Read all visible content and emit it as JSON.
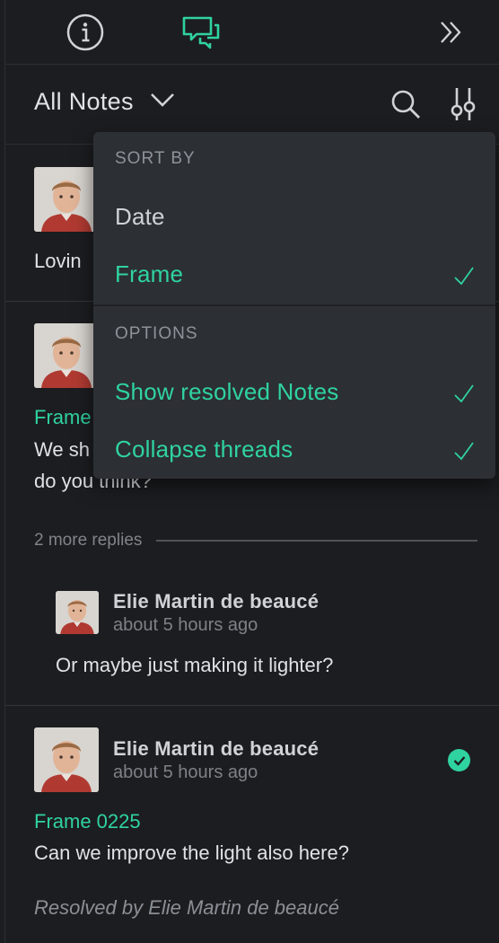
{
  "tabs": [
    {
      "name": "info",
      "icon": "info-icon",
      "active": false
    },
    {
      "name": "notes",
      "icon": "chat-bubbles-icon",
      "active": true
    },
    {
      "name": "collapse",
      "icon": "double-chevron-right-icon",
      "active": false
    }
  ],
  "header": {
    "filter_label": "All Notes",
    "search_icon": "search-icon",
    "sort_icon": "sort-options-icon"
  },
  "colors": {
    "accent": "#2fd3a0",
    "background": "#1c1d20",
    "menu_background": "#2c2f34",
    "text": "#dfe2e6",
    "muted": "#7d8188"
  },
  "notes": [
    {
      "body_visible": "Lovin"
    },
    {
      "frame_visible": "Frame",
      "body_line1_visible": "We sh",
      "body_line2_visible": "do you think?",
      "more_replies": "2 more replies",
      "reply": {
        "author": "Elie Martin de beaucé",
        "time": "about 5 hours ago",
        "body": "Or maybe just making it lighter?"
      }
    },
    {
      "author": "Elie Martin de beaucé",
      "time": "about 5 hours ago",
      "frame": "Frame 0225",
      "body": "Can we improve the light also here?",
      "resolved_by": "Resolved by Elie Martin de beaucé",
      "resolved": true
    }
  ],
  "menu": {
    "sort_by_label": "SORT BY",
    "sort_options": [
      {
        "label": "Date",
        "checked": false
      },
      {
        "label": "Frame",
        "checked": true
      }
    ],
    "options_label": "OPTIONS",
    "options": [
      {
        "label": "Show resolved Notes",
        "checked": true
      },
      {
        "label": "Collapse threads",
        "checked": true
      }
    ]
  }
}
